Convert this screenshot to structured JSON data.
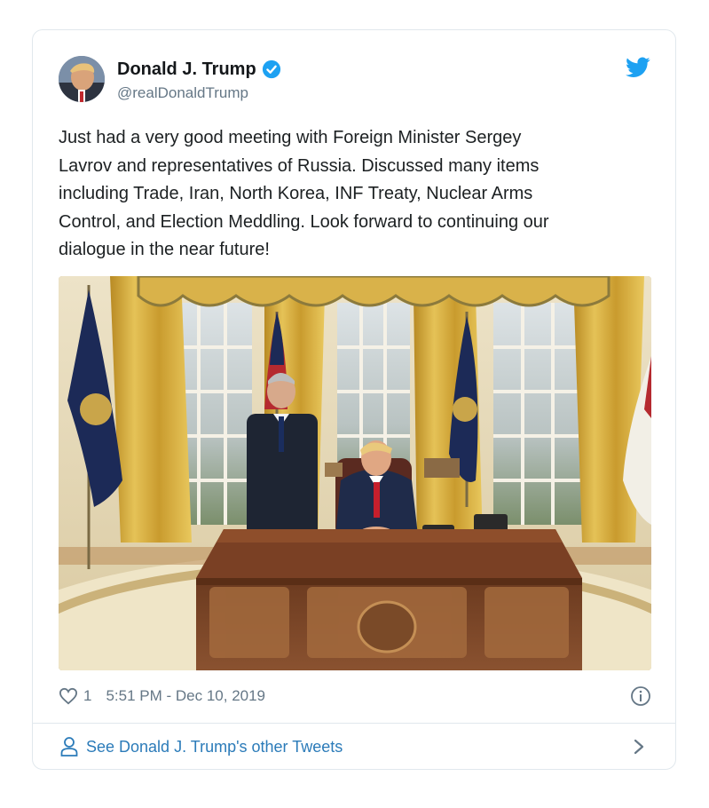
{
  "tweet": {
    "author_name": "Donald J. Trump",
    "handle": "@realDonaldTrump",
    "verified": true,
    "text": "Just had a very good meeting with Foreign Minister Sergey\nLavrov and representatives of Russia. Discussed many items\nincluding Trade, Iran, North Korea, INF Treaty, Nuclear Arms\nControl, and Election Meddling. Look forward to continuing our\ndialogue in the near future!",
    "likes": "1",
    "timestamp": "5:51 PM - Dec 10, 2019"
  },
  "footer": {
    "link_label": "See Donald J. Trump's other Tweets"
  },
  "colors": {
    "twitter_blue": "#1da1f2",
    "link_blue": "#2b7bb9",
    "muted_gray": "#657786",
    "border": "#e1e8ed"
  },
  "icons": [
    "twitter-bird-icon",
    "verified-badge-icon",
    "heart-icon",
    "info-icon",
    "person-icon",
    "chevron-right-icon"
  ]
}
